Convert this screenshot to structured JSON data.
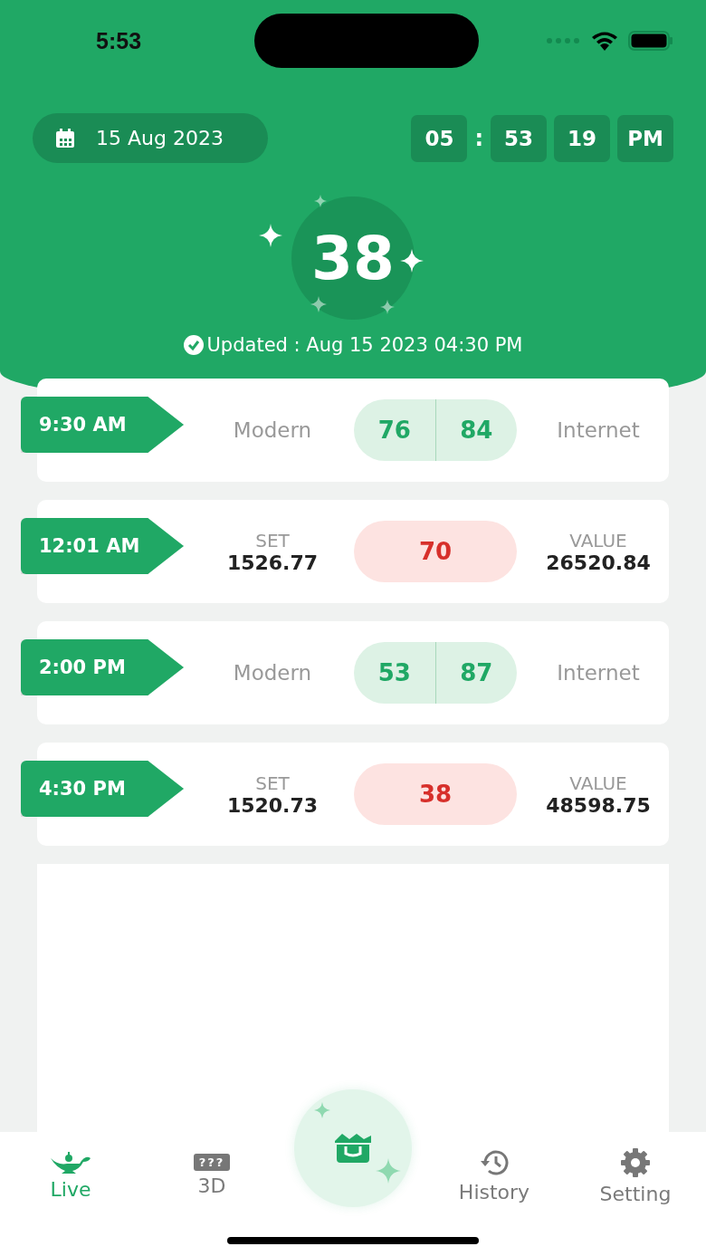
{
  "status_bar": {
    "time": "5:53"
  },
  "header": {
    "date": "15 Aug 2023",
    "clock": {
      "hour": "05",
      "separator": ":",
      "minute": "53",
      "second": "19",
      "period": "PM"
    },
    "result": "38",
    "updated": "Updated : Aug 15 2023 04:30 PM"
  },
  "results": [
    {
      "kind": "modern",
      "time": "9:30 AM",
      "left_label": "Modern",
      "numbers": [
        "76",
        "84"
      ],
      "right_label": "Internet"
    },
    {
      "kind": "set",
      "time": "12:01 AM",
      "left_label": "SET",
      "left_value": "1526.77",
      "numbers": [
        "70"
      ],
      "right_label": "VALUE",
      "right_value": "26520.84"
    },
    {
      "kind": "modern",
      "time": "2:00 PM",
      "left_label": "Modern",
      "numbers": [
        "53",
        "87"
      ],
      "right_label": "Internet"
    },
    {
      "kind": "set",
      "time": "4:30 PM",
      "left_label": "SET",
      "left_value": "1520.73",
      "numbers": [
        "38"
      ],
      "right_label": "VALUE",
      "right_value": "48598.75"
    }
  ],
  "nav": [
    {
      "kind": "lamp",
      "label": "Live",
      "selected": true
    },
    {
      "kind": "dice",
      "label": "3D",
      "icon_text": "???",
      "selected": false
    },
    {
      "kind": "center",
      "selected": false
    },
    {
      "kind": "history",
      "label": "History",
      "selected": false
    },
    {
      "kind": "gear",
      "label": "Setting",
      "selected": false
    }
  ]
}
